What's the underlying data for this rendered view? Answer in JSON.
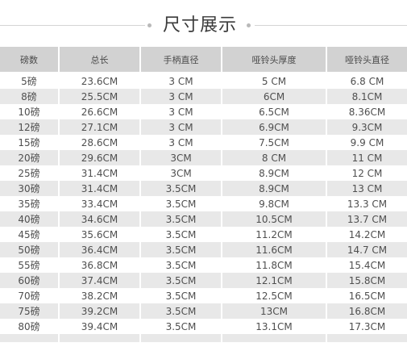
{
  "title": "尺寸展示",
  "table": {
    "headers": [
      "磅数",
      "总长",
      "手柄直径",
      "哑铃头厚度",
      "哑铃头直径"
    ],
    "rows": [
      [
        "5磅",
        "23.6CM",
        "3 CM",
        "5 CM",
        "6.8 CM"
      ],
      [
        "8磅",
        "25.5CM",
        "3 CM",
        "6CM",
        "8.1CM"
      ],
      [
        "10磅",
        "26.6CM",
        "3 CM",
        "6.5CM",
        "8.36CM"
      ],
      [
        "12磅",
        "27.1CM",
        "3 CM",
        "6.9CM",
        "9.3CM"
      ],
      [
        "15磅",
        "28.6CM",
        "3 CM",
        "7.5CM",
        "9.9 CM"
      ],
      [
        "20磅",
        "29.6CM",
        "3CM",
        "8 CM",
        "11 CM"
      ],
      [
        "25磅",
        "31.4CM",
        "3CM",
        "8.9CM",
        "12 CM"
      ],
      [
        "30磅",
        "31.4CM",
        "3.5CM",
        "8.9CM",
        "13 CM"
      ],
      [
        "35磅",
        "33.4CM",
        "3.5CM",
        "9.8CM",
        "13.3 CM"
      ],
      [
        "40磅",
        "34.6CM",
        "3.5CM",
        "10.5CM",
        "13.7 CM"
      ],
      [
        "45磅",
        "35.6CM",
        "3.5CM",
        "11.2CM",
        "14.2CM"
      ],
      [
        "50磅",
        "36.4CM",
        "3.5CM",
        "11.6CM",
        "14.7 CM"
      ],
      [
        "55磅",
        "36.8CM",
        "3.5CM",
        "11.8CM",
        "15.4CM"
      ],
      [
        "60磅",
        "37.4CM",
        "3.5CM",
        "12.1CM",
        "15.8CM"
      ],
      [
        "70磅",
        "38.2CM",
        "3.5CM",
        "12.5CM",
        "16.5CM"
      ],
      [
        "75磅",
        "39.2CM",
        "3.5CM",
        "13CM",
        "16.8CM"
      ],
      [
        "80磅",
        "39.4CM",
        "3.5CM",
        "13.1CM",
        "17.3CM"
      ]
    ]
  }
}
